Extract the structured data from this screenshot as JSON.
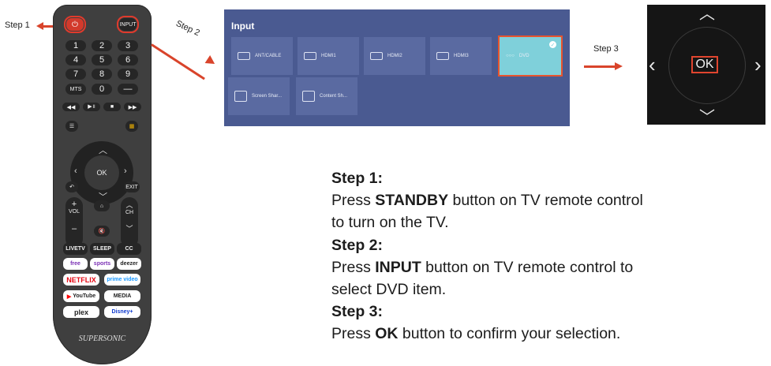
{
  "labels": {
    "step1": "Step 1",
    "step2": "Step 2",
    "step3": "Step 3"
  },
  "remote": {
    "brand": "SUPERSONIC",
    "input_label": "INPUT",
    "numbers": [
      "1",
      "2",
      "3",
      "4",
      "5",
      "6",
      "7",
      "8",
      "9"
    ],
    "mts": "MTS",
    "zero": "0",
    "dash": "—",
    "ok": "OK",
    "exit": "EXIT",
    "vol": "VOL",
    "ch": "CH",
    "row_a": [
      "LIVETV",
      "SLEEP",
      "CC"
    ],
    "row_b": [
      "free",
      "sports",
      "deezer"
    ],
    "row_c": [
      "NETFLIX",
      "prime video"
    ],
    "row_d": [
      "YouTube",
      "MEDIA"
    ],
    "row_e": [
      "plex",
      "Disney+"
    ]
  },
  "menu": {
    "title": "Input",
    "row1": [
      "ANT/CABLE",
      "HDMI1",
      "HDMI2",
      "HDMI3",
      "DVD"
    ],
    "row2": [
      "Screen Shar...",
      "Content Sh..."
    ]
  },
  "pad": {
    "ok": "OK"
  },
  "steps": {
    "s1_heading": "Step 1:",
    "s1_pre": "Press ",
    "s1_bold": "STANDBY",
    "s1_post": " button on TV remote control",
    "s1_line2": "to turn on the TV.",
    "s2_heading": "Step 2:",
    "s2_pre": "Press ",
    "s2_bold": "INPUT",
    "s2_post": " button on TV remote control to",
    "s2_line2": "select DVD item.",
    "s3_heading": "Step 3:",
    "s3_pre": "Press ",
    "s3_bold": "OK",
    "s3_post": " button to confirm your selection."
  },
  "colors": {
    "highlight": "#e03a2c",
    "menu_bg": "#4a5a91",
    "selected_tile": "#7fd0da"
  }
}
